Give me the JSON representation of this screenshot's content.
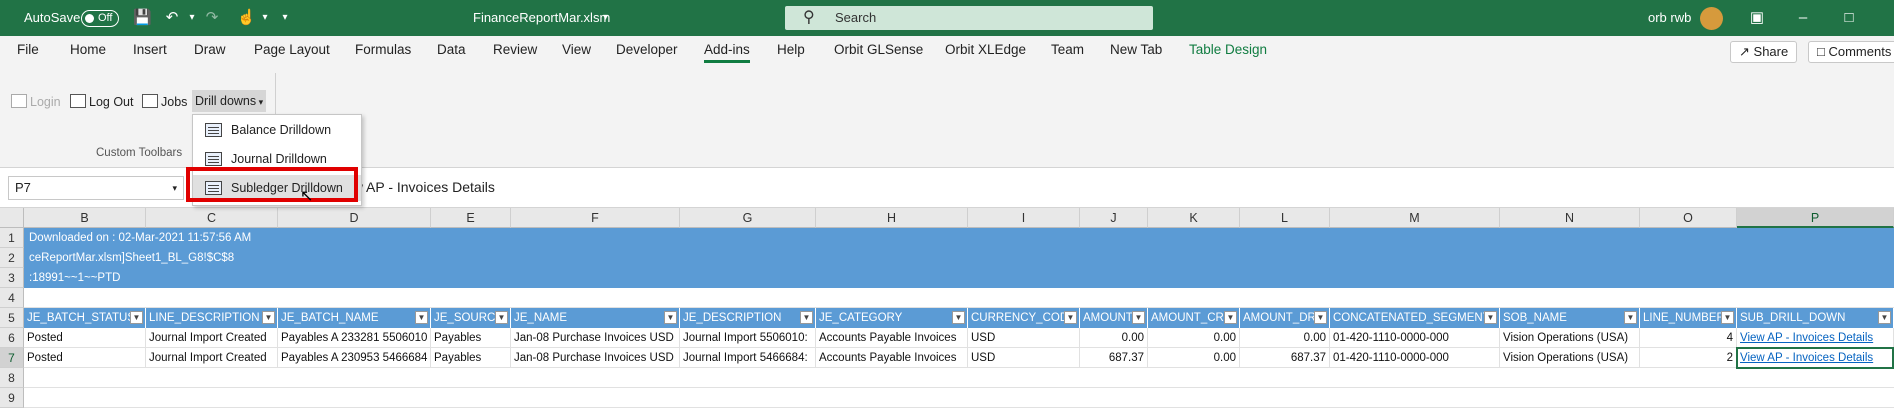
{
  "titlebar": {
    "autosave_label": "AutoSave",
    "autosave_state": "Off",
    "filename": "FinanceReportMar.xlsm",
    "search_placeholder": "Search",
    "user": "orb rwb"
  },
  "menu": {
    "tabs": [
      "File",
      "Home",
      "Insert",
      "Draw",
      "Page Layout",
      "Formulas",
      "Data",
      "Review",
      "View",
      "Developer",
      "Add-ins",
      "Help",
      "Orbit GLSense",
      "Orbit XLEdge",
      "Team",
      "New Tab",
      "Table Design"
    ],
    "active_tab": "Add-ins",
    "share_label": "Share",
    "comments_label": "Comments"
  },
  "ribbon": {
    "login": "Login",
    "logout": "Log Out",
    "jobs": "Jobs",
    "drilldowns": "Drill downs",
    "group_label": "Custom Toolbars"
  },
  "dropdown": {
    "items": [
      "Balance Drilldown",
      "Journal Drilldown",
      "Subledger Drilldown"
    ],
    "highlighted": "Subledger Drilldown"
  },
  "formula_bar": {
    "name_box": "P7",
    "formula_visible": "ew AP - Invoices Details"
  },
  "grid": {
    "columns": [
      "B",
      "C",
      "D",
      "E",
      "F",
      "G",
      "H",
      "I",
      "J",
      "K",
      "L",
      "M",
      "N",
      "O",
      "P"
    ],
    "selected_column": "P",
    "row_numbers": [
      "1",
      "2",
      "3",
      "4",
      "5",
      "6",
      "7",
      "8",
      "9"
    ],
    "selected_row": "7",
    "band_lines": [
      "Downloaded on : 02-Mar-2021 11:57:56 AM",
      "ceReportMar.xlsm]Sheet1_BL_G8!$C$8",
      ":18991~~1~~PTD"
    ],
    "headers": [
      "JE_BATCH_STATUS",
      "LINE_DESCRIPTION",
      "JE_BATCH_NAME",
      "JE_SOURCE",
      "JE_NAME",
      "JE_DESCRIPTION",
      "JE_CATEGORY",
      "CURRENCY_CODE",
      "AMOUNT",
      "AMOUNT_CR",
      "AMOUNT_DR",
      "CONCATENATED_SEGMENTS",
      "SOB_NAME",
      "LINE_NUMBER",
      "SUB_DRILL_DOWN"
    ],
    "rows": [
      [
        "Posted",
        "Journal Import Created",
        "Payables A 233281 5506010",
        "Payables",
        "Jan-08 Purchase Invoices USD",
        "Journal Import 5506010:",
        "Accounts Payable Invoices",
        "USD",
        "0.00",
        "0.00",
        "0.00",
        "01-420-1110-0000-000",
        "Vision Operations (USA)",
        "4",
        "View AP - Invoices Details"
      ],
      [
        "Posted",
        "Journal Import Created",
        "Payables A 230953 5466684",
        "Payables",
        "Jan-08 Purchase Invoices USD",
        "Journal Import 5466684:",
        "Accounts Payable Invoices",
        "USD",
        "687.37",
        "0.00",
        "687.37",
        "01-420-1110-0000-000",
        "Vision Operations (USA)",
        "2",
        "View AP - Invoices Details"
      ]
    ]
  }
}
